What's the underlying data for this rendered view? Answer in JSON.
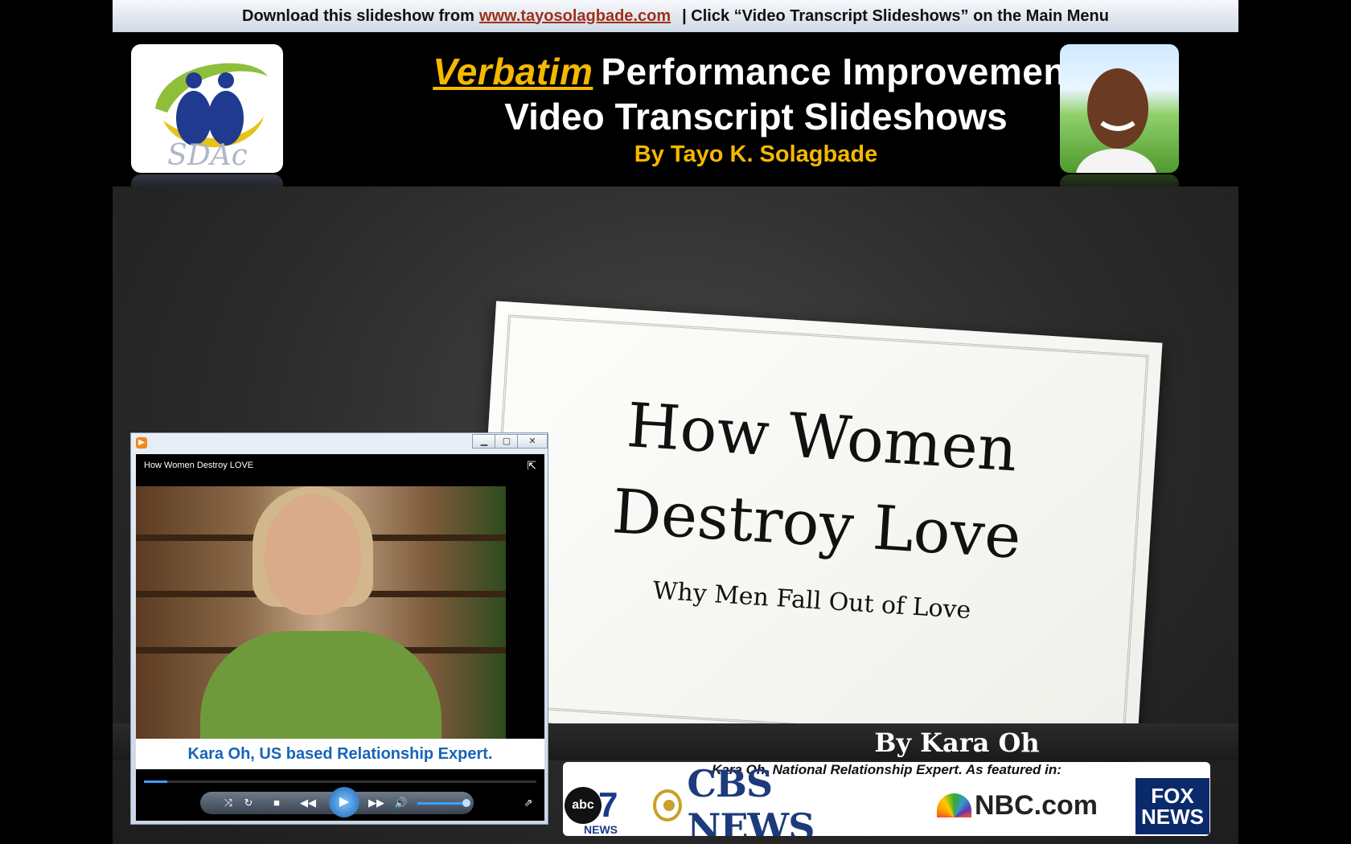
{
  "banner": {
    "prefix": "Download this slideshow from",
    "link": "www.tayosolagbade.com",
    "suffix": "| Click “Video Transcript Slideshows” on the Main Menu"
  },
  "header": {
    "title_italic": "Verbatim",
    "title_rest": "Performance Improvement",
    "title_line2": "Video Transcript Slideshows",
    "byline": "By Tayo K. Solagbade",
    "logo_text": "SDAc"
  },
  "card": {
    "title_line1": "How Women",
    "title_line2": "Destroy Love",
    "subtitle": "Why Men Fall Out of Love"
  },
  "author": "By Kara Oh",
  "media": {
    "caption": "Kara Oh, National Relationship Expert. As featured in:",
    "logos": {
      "abc": "abc",
      "abc_seven": "7",
      "abc_news": "NEWS",
      "cbs": "CBS NEWS",
      "nbc": "NBC.com",
      "fox_line1": "FOX",
      "fox_line2": "NEWS"
    }
  },
  "player": {
    "video_title": "How Women Destroy LOVE",
    "caption": "Kara Oh, US based Relationship  Expert.",
    "progress": 0.06,
    "volume": 0.85
  },
  "colors": {
    "accent_yellow": "#f5b800",
    "link_red": "#a03018",
    "caption_blue": "#1764b8"
  }
}
